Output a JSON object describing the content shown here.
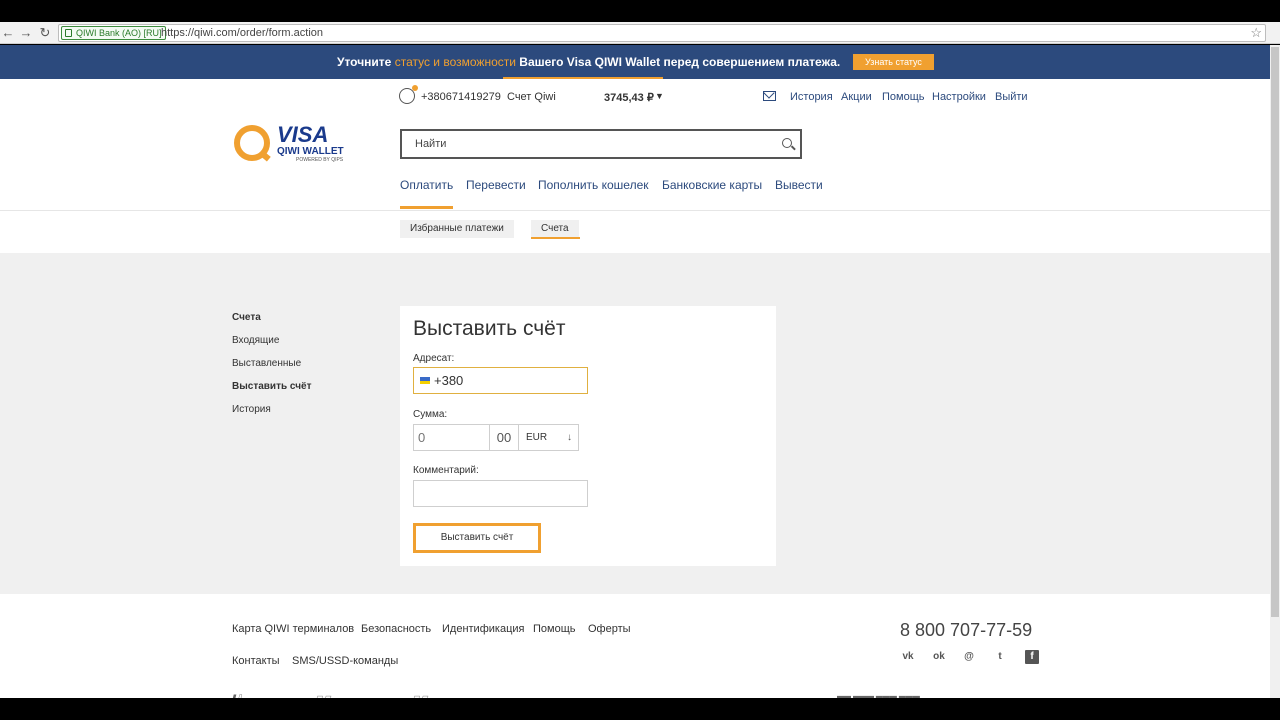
{
  "browser": {
    "secure_label": "QIWI Bank (AO) [RU]",
    "url": "https://qiwi.com/order/form.action",
    "icons": [
      "back-arrow-icon",
      "forward-arrow-icon",
      "reload-icon",
      "lock-icon",
      "star-icon"
    ]
  },
  "banner": {
    "text_before": "Уточните ",
    "highlight": "статус и возможности",
    "text_after": " Вашего Visa QIWI Wallet перед совершением платежа.",
    "button_label": "Узнать статус",
    "colors": {
      "background": "#2c4a7d",
      "accent": "#f0a030"
    }
  },
  "user": {
    "phone": "+380671419279",
    "account_label": "Счет Qiwi",
    "balance": "3745,43 ₽",
    "balance_caret": "▼"
  },
  "toplinks": [
    "История",
    "Акции",
    "Помощь",
    "Настройки",
    "Выйти"
  ],
  "logo": {
    "visa": "VISA",
    "wallet": "QIWI WALLET",
    "powered": "POWERED BY QIPS"
  },
  "search": {
    "placeholder": "Найти"
  },
  "mainnav": [
    "Оплатить",
    "Перевести",
    "Пополнить кошелек",
    "Банковские карты",
    "Вывести"
  ],
  "subtabs": [
    "Избранные платежи",
    "Счета"
  ],
  "sidebar": {
    "heading": "Счета",
    "items": [
      "Входящие",
      "Выставленные",
      "Выставить счёт",
      "История"
    ]
  },
  "form": {
    "title": "Выставить счёт",
    "recipient_label": "Адресат:",
    "recipient_value": "+380",
    "amount_label": "Сумма:",
    "amount_value": "0",
    "cents_value": "00",
    "currency": "EUR",
    "currency_arrow": "↓",
    "comment_label": "Комментарий:",
    "comment_value": "",
    "submit_label": "Выставить счёт"
  },
  "footer": {
    "links_row1": [
      "Карта QIWI терминалов",
      "Безопасность",
      "Идентификация",
      "Помощь",
      "Оферты"
    ],
    "links_row2": [
      "Контакты",
      "SMS/USSD-команды"
    ],
    "phone": "8 800 707-77-59",
    "social": [
      "vk-icon",
      "odnoklassniki-icon",
      "mailru-icon",
      "twitter-icon",
      "facebook-icon"
    ]
  }
}
